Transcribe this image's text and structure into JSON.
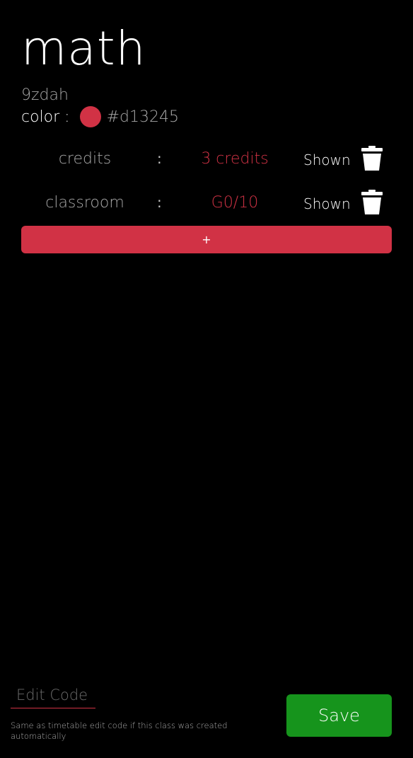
{
  "class": {
    "title": "math",
    "id": "9zdah",
    "color_label": "color :",
    "color_hex": "#d13245"
  },
  "properties": [
    {
      "name": "credits",
      "separator": ":",
      "value": "3 credits",
      "visibility": "Shown"
    },
    {
      "name": "classroom",
      "separator": ":",
      "value": "G0/10",
      "visibility": "Shown"
    }
  ],
  "add_button": {
    "label": "+"
  },
  "edit_code": {
    "placeholder": "Edit Code",
    "value": "",
    "hint": "Same as timetable edit code if this class was created automatically"
  },
  "save_button": {
    "label": "Save"
  },
  "colors": {
    "accent": "#d13245",
    "save": "#16941c",
    "background": "#000000"
  },
  "icons": {
    "delete": "trash-icon"
  }
}
